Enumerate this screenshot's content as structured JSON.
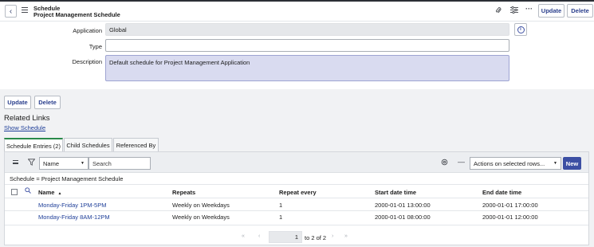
{
  "header": {
    "title_line1": "Schedule",
    "title_line2": "Project Management Schedule",
    "update_label": "Update",
    "delete_label": "Delete",
    "icons": [
      "paperclip-icon",
      "sliders-icon",
      "more-icon"
    ]
  },
  "form": {
    "application_label": "Application",
    "application_value": "Global",
    "type_label": "Type",
    "type_value": "",
    "description_label": "Description",
    "description_value": "Default schedule for Project Management Application"
  },
  "bottom_buttons": {
    "update_label": "Update",
    "delete_label": "Delete"
  },
  "related": {
    "title": "Related Links",
    "show_schedule": "Show Schedule"
  },
  "tabs": [
    {
      "label": "Schedule Entries (2)",
      "active": true
    },
    {
      "label": "Child Schedules",
      "active": false
    },
    {
      "label": "Referenced By",
      "active": false
    }
  ],
  "list": {
    "search_field": "Name",
    "search_placeholder": "Search",
    "actions_label": "Actions on selected rows...",
    "new_label": "New",
    "breadcrumb": "Schedule = Project Management Schedule",
    "columns": [
      "Name",
      "Repeats",
      "Repeat every",
      "Start date time",
      "End date time"
    ],
    "sort_indicator": "▲",
    "rows": [
      {
        "name": "Monday-Friday 1PM-5PM",
        "repeats": "Weekly on Weekdays",
        "repeat_every": "1",
        "start": "2000-01-01 13:00:00",
        "end": "2000-01-01 17:00:00"
      },
      {
        "name": "Monday-Friday 8AM-12PM",
        "repeats": "Weekly on Weekdays",
        "repeat_every": "1",
        "start": "2000-01-01 08:00:00",
        "end": "2000-01-01 12:00:00"
      }
    ],
    "pager_value": "1",
    "pager_text": "to 2 of 2"
  },
  "colors": {
    "accent": "#3c4fa3",
    "link": "#1f3f99",
    "active_tab": "#2a8a4a"
  }
}
